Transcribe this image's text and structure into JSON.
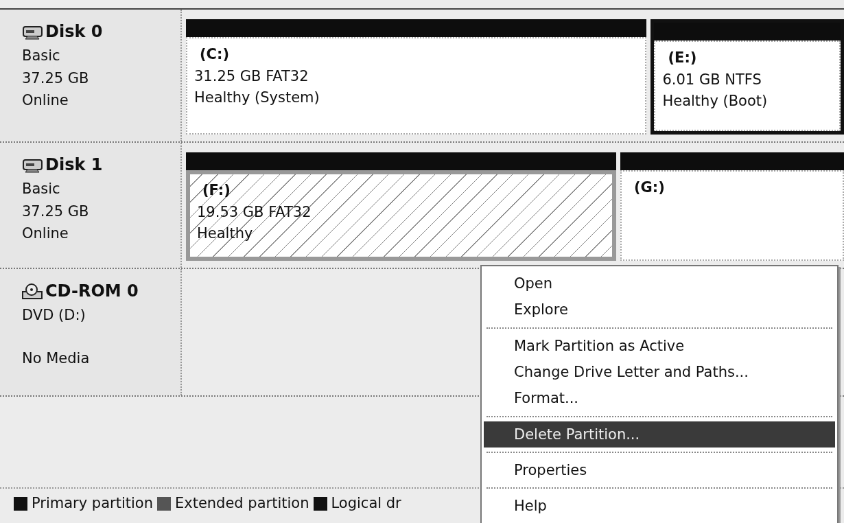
{
  "disks": [
    {
      "name": "Disk 0",
      "kind": "disk",
      "lines": [
        "Basic",
        "37.25 GB",
        "Online"
      ],
      "partitions": [
        {
          "label": "(C:)",
          "detail": "31.25 GB FAT32",
          "status": "Healthy (System)",
          "selected": false,
          "focused": false
        },
        {
          "label": "(E:)",
          "detail": "6.01 GB NTFS",
          "status": "Healthy (Boot)",
          "selected": false,
          "focused": true
        }
      ]
    },
    {
      "name": "Disk 1",
      "kind": "disk",
      "lines": [
        "Basic",
        "37.25 GB",
        "Online"
      ],
      "partitions": [
        {
          "label": "(F:)",
          "detail": "19.53 GB FAT32",
          "status": "Healthy",
          "selected": true,
          "focused": false
        },
        {
          "label": "(G:)",
          "selected": false,
          "focused": false
        }
      ]
    },
    {
      "name": "CD-ROM 0",
      "kind": "cdrom",
      "lines": [
        "DVD (D:)",
        "No Media"
      ]
    }
  ],
  "legend": [
    {
      "label": "Primary partition",
      "color": "#111111"
    },
    {
      "label": "Extended partition",
      "color": "#555555"
    },
    {
      "label": "Logical dr",
      "color": "#111111"
    }
  ],
  "context_menu": [
    {
      "kind": "item",
      "label": "Open",
      "selected": false
    },
    {
      "kind": "item",
      "label": "Explore",
      "selected": false
    },
    {
      "kind": "separator"
    },
    {
      "kind": "item",
      "label": "Mark Partition as Active",
      "selected": false
    },
    {
      "kind": "item",
      "label": "Change Drive Letter and Paths...",
      "selected": false
    },
    {
      "kind": "item",
      "label": "Format...",
      "selected": false
    },
    {
      "kind": "separator"
    },
    {
      "kind": "item",
      "label": "Delete Partition...",
      "selected": true
    },
    {
      "kind": "separator"
    },
    {
      "kind": "item",
      "label": "Properties",
      "selected": false
    },
    {
      "kind": "separator"
    },
    {
      "kind": "item",
      "label": "Help",
      "selected": false
    }
  ]
}
